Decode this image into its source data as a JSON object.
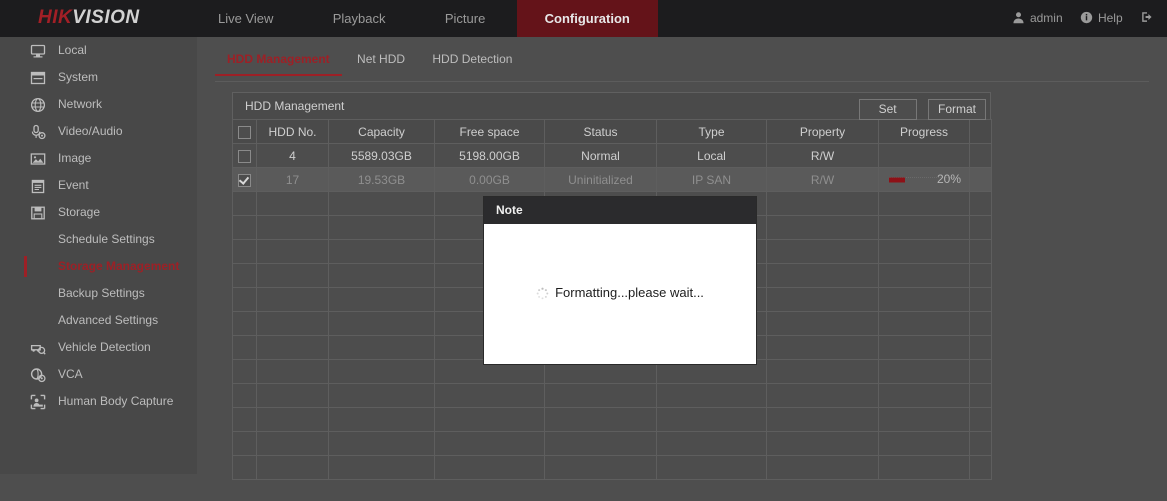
{
  "header": {
    "logo_hik": "HIK",
    "logo_vision": "VISION",
    "nav": [
      {
        "label": "Live View",
        "active": false
      },
      {
        "label": "Playback",
        "active": false
      },
      {
        "label": "Picture",
        "active": false
      },
      {
        "label": "Configuration",
        "active": true
      }
    ],
    "user": "admin",
    "help": "Help",
    "icons": {
      "user": "user-icon",
      "help": "info-icon",
      "logout": "logout-icon"
    },
    "accent": "#641319"
  },
  "sidebar": {
    "items": [
      {
        "label": "Local",
        "icon": "monitor-icon",
        "type": "group",
        "active": false
      },
      {
        "label": "System",
        "icon": "window-icon",
        "type": "group",
        "active": false
      },
      {
        "label": "Network",
        "icon": "globe-icon",
        "type": "group",
        "active": false
      },
      {
        "label": "Video/Audio",
        "icon": "microphone-icon",
        "type": "group",
        "active": false
      },
      {
        "label": "Image",
        "icon": "picture-icon",
        "type": "group",
        "active": false
      },
      {
        "label": "Event",
        "icon": "clipboard-icon",
        "type": "group",
        "active": false
      },
      {
        "label": "Storage",
        "icon": "floppy-disk-icon",
        "type": "group",
        "active": false
      },
      {
        "label": "Schedule Settings",
        "icon": "",
        "type": "sub",
        "active": false
      },
      {
        "label": "Storage Management",
        "icon": "",
        "type": "sub",
        "active": true
      },
      {
        "label": "Backup Settings",
        "icon": "",
        "type": "sub",
        "active": false
      },
      {
        "label": "Advanced Settings",
        "icon": "",
        "type": "sub",
        "active": false
      },
      {
        "label": "Vehicle Detection",
        "icon": "vehicle-icon",
        "type": "group",
        "active": false
      },
      {
        "label": "VCA",
        "icon": "vca-icon",
        "type": "group",
        "active": false
      },
      {
        "label": "Human Body Capture",
        "icon": "human-body-icon",
        "type": "group",
        "active": false
      }
    ],
    "active_color": "#9d2026"
  },
  "main": {
    "tabs": [
      {
        "label": "HDD Management",
        "active": true
      },
      {
        "label": "Net HDD",
        "active": false
      },
      {
        "label": "HDD Detection",
        "active": false
      }
    ],
    "panel": {
      "title": "HDD Management",
      "buttons": [
        {
          "label": "Set",
          "name": "set-button"
        },
        {
          "label": "Format",
          "name": "format-button"
        }
      ],
      "columns": [
        "HDD No.",
        "Capacity",
        "Free space",
        "Status",
        "Type",
        "Property",
        "Progress"
      ],
      "rows": [
        {
          "checked": false,
          "selected": false,
          "hdd_no": "4",
          "capacity": "5589.03GB",
          "free_space": "5198.00GB",
          "status": "Normal",
          "type": "Local",
          "property": "R/W",
          "progress": "",
          "progress_pct": 0
        },
        {
          "checked": true,
          "selected": true,
          "hdd_no": "17",
          "capacity": "19.53GB",
          "free_space": "0.00GB",
          "status": "Uninitialized",
          "type": "IP SAN",
          "property": "R/W",
          "progress": "20%",
          "progress_pct": 20
        }
      ],
      "blank_rows": 12,
      "progress_color": "#8e1117"
    }
  },
  "modal": {
    "title": "Note",
    "message": "Formatting...please wait...",
    "spinner": "loading-spinner-icon"
  }
}
